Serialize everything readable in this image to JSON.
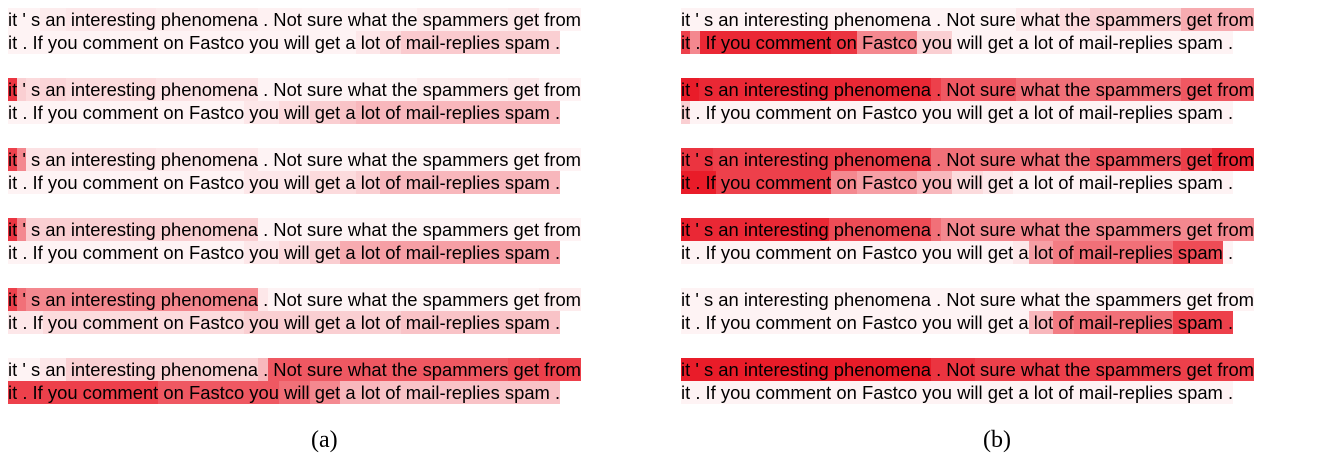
{
  "sentence": {
    "line1": [
      "it",
      " '",
      " s",
      " an",
      " interesting",
      " phenomena",
      " .",
      " Not",
      " sure",
      " what",
      " the",
      " spammers",
      " get",
      " from"
    ],
    "line2": [
      "it",
      " .",
      " If",
      " you",
      " comment",
      " on",
      " Fastco",
      " you",
      " will",
      " get",
      " a",
      " lot",
      " of",
      " mail-replies",
      " spam",
      " ."
    ]
  },
  "colors": {
    "highlight": "#e8101e",
    "text": "#000000"
  },
  "panels": [
    {
      "label": "(a)",
      "rows": [
        {
          "line1": [
            0.05,
            0.05,
            0.05,
            0.08,
            0.1,
            0.08,
            0.06,
            0.06,
            0.05,
            0.05,
            0.05,
            0.08,
            0.1,
            0.05
          ],
          "line2": [
            0.05,
            0.05,
            0.05,
            0.05,
            0.05,
            0.05,
            0.05,
            0.05,
            0.05,
            0.05,
            0.05,
            0.1,
            0.15,
            0.22,
            0.2,
            0.2
          ]
        },
        {
          "line1": [
            0.85,
            0.2,
            0.15,
            0.18,
            0.15,
            0.12,
            0.05,
            0.05,
            0.05,
            0.05,
            0.05,
            0.08,
            0.1,
            0.05
          ],
          "line2": [
            0.05,
            0.05,
            0.05,
            0.05,
            0.05,
            0.05,
            0.05,
            0.1,
            0.15,
            0.2,
            0.25,
            0.3,
            0.3,
            0.3,
            0.3,
            0.3
          ]
        },
        {
          "line1": [
            0.8,
            0.5,
            0.12,
            0.12,
            0.12,
            0.1,
            0.05,
            0.05,
            0.05,
            0.05,
            0.05,
            0.05,
            0.05,
            0.05
          ],
          "line2": [
            0.05,
            0.05,
            0.05,
            0.05,
            0.05,
            0.05,
            0.05,
            0.1,
            0.1,
            0.15,
            0.15,
            0.2,
            0.3,
            0.3,
            0.3,
            0.3
          ]
        },
        {
          "line1": [
            0.85,
            0.5,
            0.2,
            0.2,
            0.2,
            0.2,
            0.05,
            0.05,
            0.05,
            0.05,
            0.05,
            0.05,
            0.05,
            0.05
          ],
          "line2": [
            0.05,
            0.05,
            0.05,
            0.05,
            0.05,
            0.05,
            0.05,
            0.1,
            0.15,
            0.2,
            0.35,
            0.35,
            0.4,
            0.4,
            0.4,
            0.4
          ]
        },
        {
          "line1": [
            0.8,
            0.6,
            0.5,
            0.5,
            0.5,
            0.5,
            0.1,
            0.05,
            0.05,
            0.05,
            0.05,
            0.05,
            0.05,
            0.08
          ],
          "line2": [
            0.1,
            0.1,
            0.1,
            0.15,
            0.15,
            0.15,
            0.15,
            0.2,
            0.2,
            0.2,
            0.2,
            0.2,
            0.2,
            0.25,
            0.25,
            0.25
          ]
        },
        {
          "line1": [
            0.05,
            0.05,
            0.05,
            0.1,
            0.2,
            0.2,
            0.3,
            0.7,
            0.7,
            0.7,
            0.7,
            0.7,
            0.75,
            0.8
          ],
          "line2": [
            0.8,
            0.8,
            0.8,
            0.8,
            0.8,
            0.7,
            0.7,
            0.7,
            0.6,
            0.5,
            0.3,
            0.3,
            0.25,
            0.25,
            0.25,
            0.25
          ]
        }
      ]
    },
    {
      "label": "(b)",
      "rows": [
        {
          "line1": [
            0.05,
            0.05,
            0.05,
            0.05,
            0.05,
            0.05,
            0.05,
            0.05,
            0.05,
            0.1,
            0.15,
            0.2,
            0.35,
            0.35
          ],
          "line2": [
            0.8,
            0.5,
            0.9,
            0.9,
            0.9,
            0.85,
            0.5,
            0.2,
            0.05,
            0.05,
            0.05,
            0.05,
            0.05,
            0.05,
            0.05,
            0.05
          ]
        },
        {
          "line1": [
            0.95,
            0.95,
            0.9,
            0.9,
            0.9,
            0.9,
            0.8,
            0.7,
            0.7,
            0.6,
            0.6,
            0.6,
            0.7,
            0.7
          ],
          "line2": [
            0.2,
            0.05,
            0.05,
            0.05,
            0.05,
            0.05,
            0.05,
            0.05,
            0.05,
            0.05,
            0.05,
            0.05,
            0.05,
            0.05,
            0.05,
            0.05
          ]
        },
        {
          "line1": [
            0.85,
            0.85,
            0.85,
            0.8,
            0.8,
            0.8,
            0.6,
            0.6,
            0.6,
            0.6,
            0.6,
            0.7,
            0.8,
            0.9
          ],
          "line2": [
            0.95,
            0.95,
            0.95,
            0.8,
            0.8,
            0.5,
            0.4,
            0.3,
            0.15,
            0.1,
            0.05,
            0.05,
            0.05,
            0.05,
            0.05,
            0.05
          ]
        },
        {
          "line1": [
            0.95,
            0.9,
            0.9,
            0.9,
            0.9,
            0.75,
            0.6,
            0.5,
            0.5,
            0.5,
            0.5,
            0.5,
            0.5,
            0.5
          ],
          "line2": [
            0.05,
            0.05,
            0.05,
            0.05,
            0.05,
            0.05,
            0.05,
            0.05,
            0.05,
            0.05,
            0.1,
            0.4,
            0.55,
            0.6,
            0.75,
            0.05
          ]
        },
        {
          "line1": [
            0.05,
            0.05,
            0.05,
            0.05,
            0.05,
            0.05,
            0.05,
            0.05,
            0.05,
            0.05,
            0.05,
            0.05,
            0.05,
            0.05
          ],
          "line2": [
            0.05,
            0.05,
            0.05,
            0.05,
            0.05,
            0.05,
            0.05,
            0.05,
            0.05,
            0.05,
            0.05,
            0.3,
            0.55,
            0.6,
            0.8,
            0.8
          ]
        },
        {
          "line1": [
            0.95,
            0.95,
            0.95,
            0.95,
            0.95,
            0.95,
            0.85,
            0.85,
            0.8,
            0.8,
            0.8,
            0.8,
            0.8,
            0.8
          ],
          "line2": [
            0.05,
            0.05,
            0.05,
            0.05,
            0.05,
            0.05,
            0.05,
            0.05,
            0.05,
            0.05,
            0.05,
            0.05,
            0.05,
            0.05,
            0.05,
            0.05
          ]
        }
      ]
    }
  ]
}
